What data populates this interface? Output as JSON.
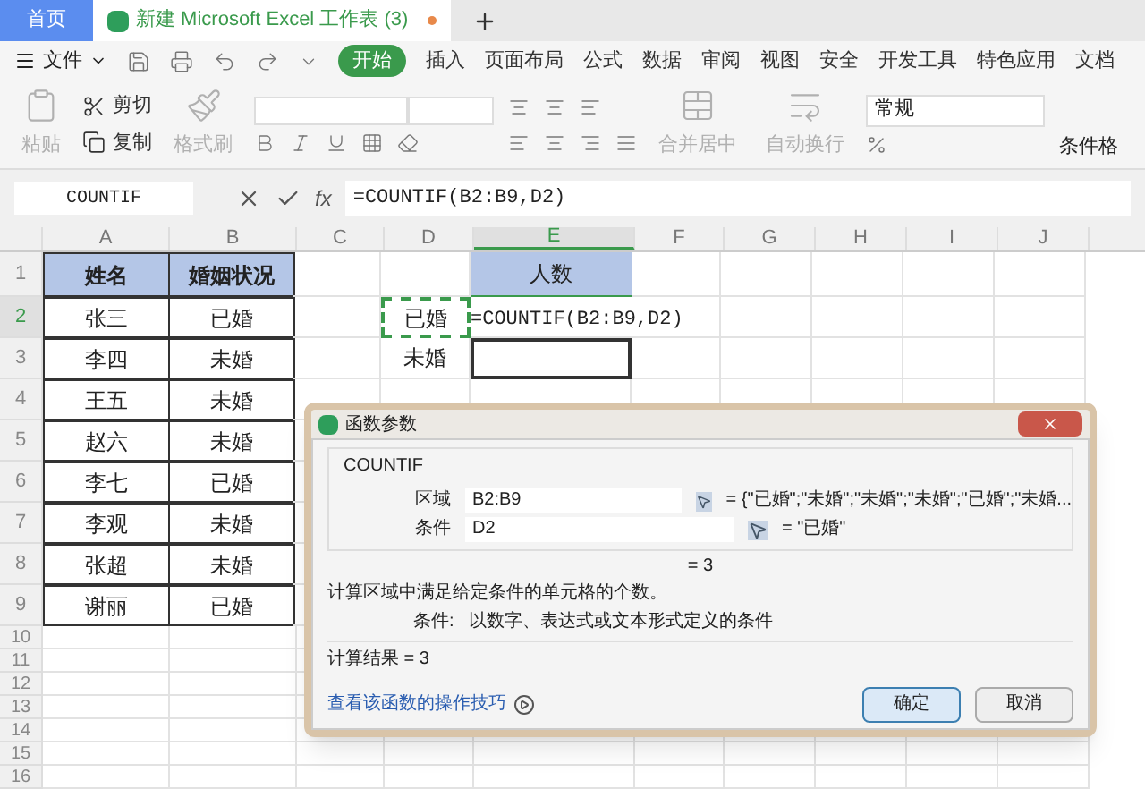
{
  "tabs": [
    {
      "label": "首页",
      "kind": "home",
      "selected": false
    },
    {
      "label": "新建 Microsoft Excel 工作表 (3)",
      "kind": "doc",
      "selected": true
    }
  ],
  "menu": {
    "file": "文件",
    "items": [
      {
        "label": "开始",
        "selected": true
      },
      {
        "label": "插入",
        "selected": false
      },
      {
        "label": "页面布局",
        "selected": false
      },
      {
        "label": "公式",
        "selected": false
      },
      {
        "label": "数据",
        "selected": false
      },
      {
        "label": "审阅",
        "selected": false
      },
      {
        "label": "视图",
        "selected": false
      },
      {
        "label": "安全",
        "selected": false
      },
      {
        "label": "开发工具",
        "selected": false
      },
      {
        "label": "特色应用",
        "selected": false
      },
      {
        "label": "文档",
        "selected": false
      }
    ]
  },
  "ribbon": {
    "paste": {
      "label": "粘贴",
      "disabled": true
    },
    "cut": {
      "label": "剪切",
      "disabled": false
    },
    "copy": {
      "label": "复制",
      "disabled": false
    },
    "format_painter": {
      "label": "格式刷",
      "disabled": true
    },
    "merge": {
      "label": "合并居中",
      "disabled": true
    },
    "wrap": {
      "label": "自动换行",
      "disabled": true
    },
    "number_format": "常规",
    "conditional": "条件格"
  },
  "formula_bar": {
    "name_box": "COUNTIF",
    "fx": "fx",
    "formula": "=COUNTIF(B2:B9,D2)"
  },
  "sheet": {
    "columns": [
      {
        "label": "A",
        "selected": false
      },
      {
        "label": "B",
        "selected": false
      },
      {
        "label": "C",
        "selected": false
      },
      {
        "label": "D",
        "selected": false
      },
      {
        "label": "E",
        "selected": true
      },
      {
        "label": "F",
        "selected": false
      },
      {
        "label": "G",
        "selected": false
      },
      {
        "label": "H",
        "selected": false
      },
      {
        "label": "I",
        "selected": false
      },
      {
        "label": "J",
        "selected": false
      }
    ],
    "rows": [
      {
        "label": "1",
        "selected": false,
        "kind": "normal",
        "cells": [
          {
            "kind": "header",
            "text": "姓名"
          },
          {
            "kind": "header",
            "text": "婚姻状况"
          },
          {
            "kind": "empty"
          },
          {
            "kind": "empty"
          },
          {
            "kind": "title",
            "text": "人数"
          }
        ]
      },
      {
        "label": "2",
        "selected": true,
        "kind": "normal",
        "cells": [
          {
            "kind": "data",
            "text": "张三"
          },
          {
            "kind": "data",
            "text": "已婚"
          },
          {
            "kind": "empty"
          },
          {
            "kind": "copy",
            "text": "已婚"
          },
          {
            "kind": "formula",
            "text": "=COUNTIF(B2:B9,D2)"
          }
        ]
      },
      {
        "label": "3",
        "selected": false,
        "kind": "normal",
        "cells": [
          {
            "kind": "data",
            "text": "李四"
          },
          {
            "kind": "data",
            "text": "未婚"
          },
          {
            "kind": "empty"
          },
          {
            "kind": "label",
            "text": "未婚"
          },
          {
            "kind": "outlined"
          }
        ]
      },
      {
        "label": "4",
        "selected": false,
        "kind": "normal",
        "cells": [
          {
            "kind": "data",
            "text": "王五"
          },
          {
            "kind": "data",
            "text": "未婚"
          }
        ]
      },
      {
        "label": "5",
        "selected": false,
        "kind": "normal",
        "cells": [
          {
            "kind": "data",
            "text": "赵六"
          },
          {
            "kind": "data",
            "text": "未婚"
          }
        ]
      },
      {
        "label": "6",
        "selected": false,
        "kind": "normal",
        "cells": [
          {
            "kind": "data",
            "text": "李七"
          },
          {
            "kind": "data",
            "text": "已婚"
          }
        ]
      },
      {
        "label": "7",
        "selected": false,
        "kind": "normal",
        "cells": [
          {
            "kind": "data",
            "text": "李观"
          },
          {
            "kind": "data",
            "text": "未婚"
          }
        ]
      },
      {
        "label": "8",
        "selected": false,
        "kind": "normal",
        "cells": [
          {
            "kind": "data",
            "text": "张超"
          },
          {
            "kind": "data",
            "text": "未婚"
          }
        ]
      },
      {
        "label": "9",
        "selected": false,
        "kind": "normal",
        "cells": [
          {
            "kind": "data",
            "text": "谢丽"
          },
          {
            "kind": "data",
            "text": "已婚"
          }
        ]
      },
      {
        "label": "10",
        "selected": false,
        "kind": "compact",
        "cells": []
      },
      {
        "label": "11",
        "selected": false,
        "kind": "compact",
        "cells": []
      },
      {
        "label": "12",
        "selected": false,
        "kind": "compact",
        "cells": []
      },
      {
        "label": "13",
        "selected": false,
        "kind": "compact",
        "cells": []
      },
      {
        "label": "14",
        "selected": false,
        "kind": "compact",
        "cells": []
      },
      {
        "label": "15",
        "selected": false,
        "kind": "compact",
        "cells": []
      },
      {
        "label": "16",
        "selected": false,
        "kind": "compact",
        "cells": []
      }
    ]
  },
  "dialog": {
    "title": "函数参数",
    "function": "COUNTIF",
    "args": [
      {
        "label": "区域",
        "value": "B2:B9",
        "result": "= {\"已婚\";\"未婚\";\"未婚\";\"未婚\";\"已婚\";\"未婚..."
      },
      {
        "label": "条件",
        "value": "D2",
        "result": "= \"已婚\""
      }
    ],
    "total": "= 3",
    "description": "计算区域中满足给定条件的单元格的个数。",
    "arg_help_label": "条件:",
    "arg_help": "以数字、表达式或文本形式定义的条件",
    "result": "计算结果 = 3",
    "link": "查看该函数的操作技巧",
    "buttons": [
      {
        "label": "确定",
        "kind": "primary"
      },
      {
        "label": "取消",
        "kind": "secondary"
      }
    ]
  }
}
